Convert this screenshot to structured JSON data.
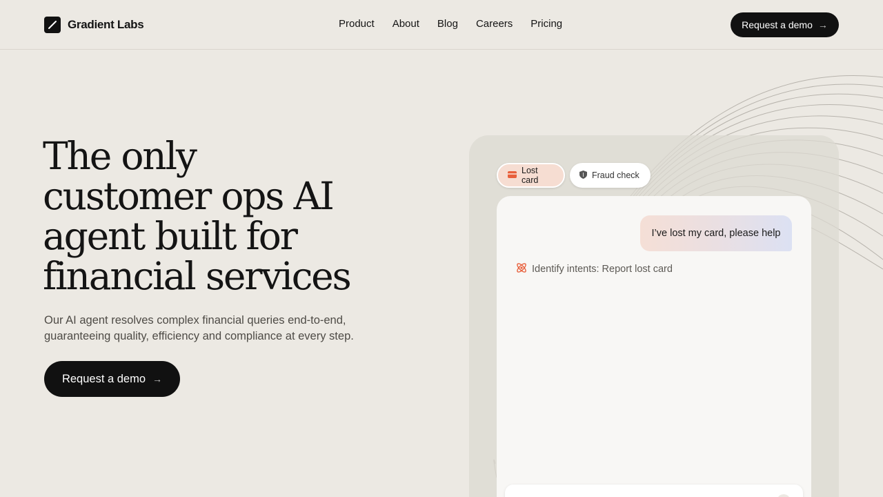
{
  "header": {
    "brand": "Gradient Labs",
    "nav": [
      "Product",
      "About",
      "Blog",
      "Careers",
      "Pricing"
    ],
    "cta_label": "Request a demo"
  },
  "hero": {
    "title_lines": [
      "The only",
      "customer ops AI",
      "agent built for",
      "financial services"
    ],
    "subtitle_lines": [
      "Our AI agent resolves complex financial queries end-to-end,",
      "guaranteeing quality, efficiency and compliance at every step."
    ],
    "cta_label": "Request a demo"
  },
  "demo": {
    "chips": [
      {
        "label": "Lost card",
        "icon": "card-icon",
        "active": true
      },
      {
        "label": "Fraud check",
        "icon": "shield-icon",
        "active": false
      }
    ],
    "user_message": "I’ve lost my card, please help",
    "intent_text": "Identify intents: Report lost card",
    "intent_icon": "atom-icon"
  },
  "colors": {
    "background": "#ece9e3",
    "button": "#111111",
    "accent": "#e8603c"
  }
}
